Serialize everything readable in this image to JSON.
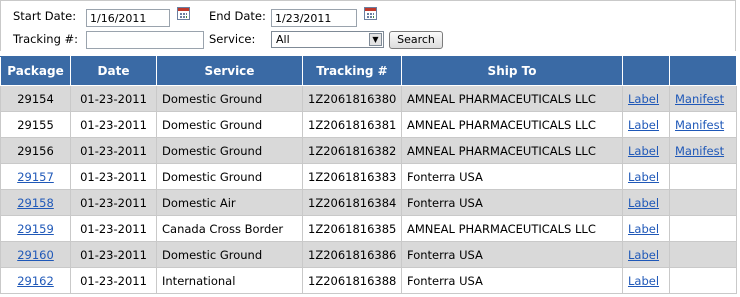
{
  "filters": {
    "start_date_label": "Start Date:",
    "start_date_value": "1/16/2011",
    "end_date_label": "End Date:",
    "end_date_value": "1/23/2011",
    "tracking_label": "Tracking #:",
    "tracking_value": "",
    "service_label": "Service:",
    "service_value": "All",
    "search_label": "Search"
  },
  "table": {
    "headers": [
      "Package",
      "Date",
      "Service",
      "Tracking #",
      "Ship To",
      "",
      ""
    ],
    "rows": [
      {
        "package": "29154",
        "package_link": false,
        "date": "01-23-2011",
        "service": "Domestic Ground",
        "tracking": "1Z2061816380",
        "ship_to": "AMNEAL PHARMACEUTICALS LLC",
        "label": "Label",
        "manifest": "Manifest"
      },
      {
        "package": "29155",
        "package_link": false,
        "date": "01-23-2011",
        "service": "Domestic Ground",
        "tracking": "1Z2061816381",
        "ship_to": "AMNEAL PHARMACEUTICALS LLC",
        "label": "Label",
        "manifest": "Manifest"
      },
      {
        "package": "29156",
        "package_link": false,
        "date": "01-23-2011",
        "service": "Domestic Ground",
        "tracking": "1Z2061816382",
        "ship_to": "AMNEAL PHARMACEUTICALS LLC",
        "label": "Label",
        "manifest": "Manifest"
      },
      {
        "package": "29157",
        "package_link": true,
        "date": "01-23-2011",
        "service": "Domestic Ground",
        "tracking": "1Z2061816383",
        "ship_to": "Fonterra USA",
        "label": "Label",
        "manifest": ""
      },
      {
        "package": "29158",
        "package_link": true,
        "date": "01-23-2011",
        "service": "Domestic Air",
        "tracking": "1Z2061816384",
        "ship_to": "Fonterra USA",
        "label": "Label",
        "manifest": ""
      },
      {
        "package": "29159",
        "package_link": true,
        "date": "01-23-2011",
        "service": "Canada Cross Border",
        "tracking": "1Z2061816385",
        "ship_to": "AMNEAL PHARMACEUTICALS LLC",
        "label": "Label",
        "manifest": ""
      },
      {
        "package": "29160",
        "package_link": true,
        "date": "01-23-2011",
        "service": "Domestic Ground",
        "tracking": "1Z2061816386",
        "ship_to": "Fonterra USA",
        "label": "Label",
        "manifest": ""
      },
      {
        "package": "29162",
        "package_link": true,
        "date": "01-23-2011",
        "service": "International",
        "tracking": "1Z2061816388",
        "ship_to": "Fonterra USA",
        "label": "Label",
        "manifest": ""
      }
    ]
  },
  "icons": {
    "calendar": "calendar-icon",
    "dropdown": "chevron-down-icon"
  },
  "colors": {
    "header_bg": "#3a6aa5",
    "row_alt_bg": "#d9d9d9",
    "link": "#1f58b8"
  }
}
